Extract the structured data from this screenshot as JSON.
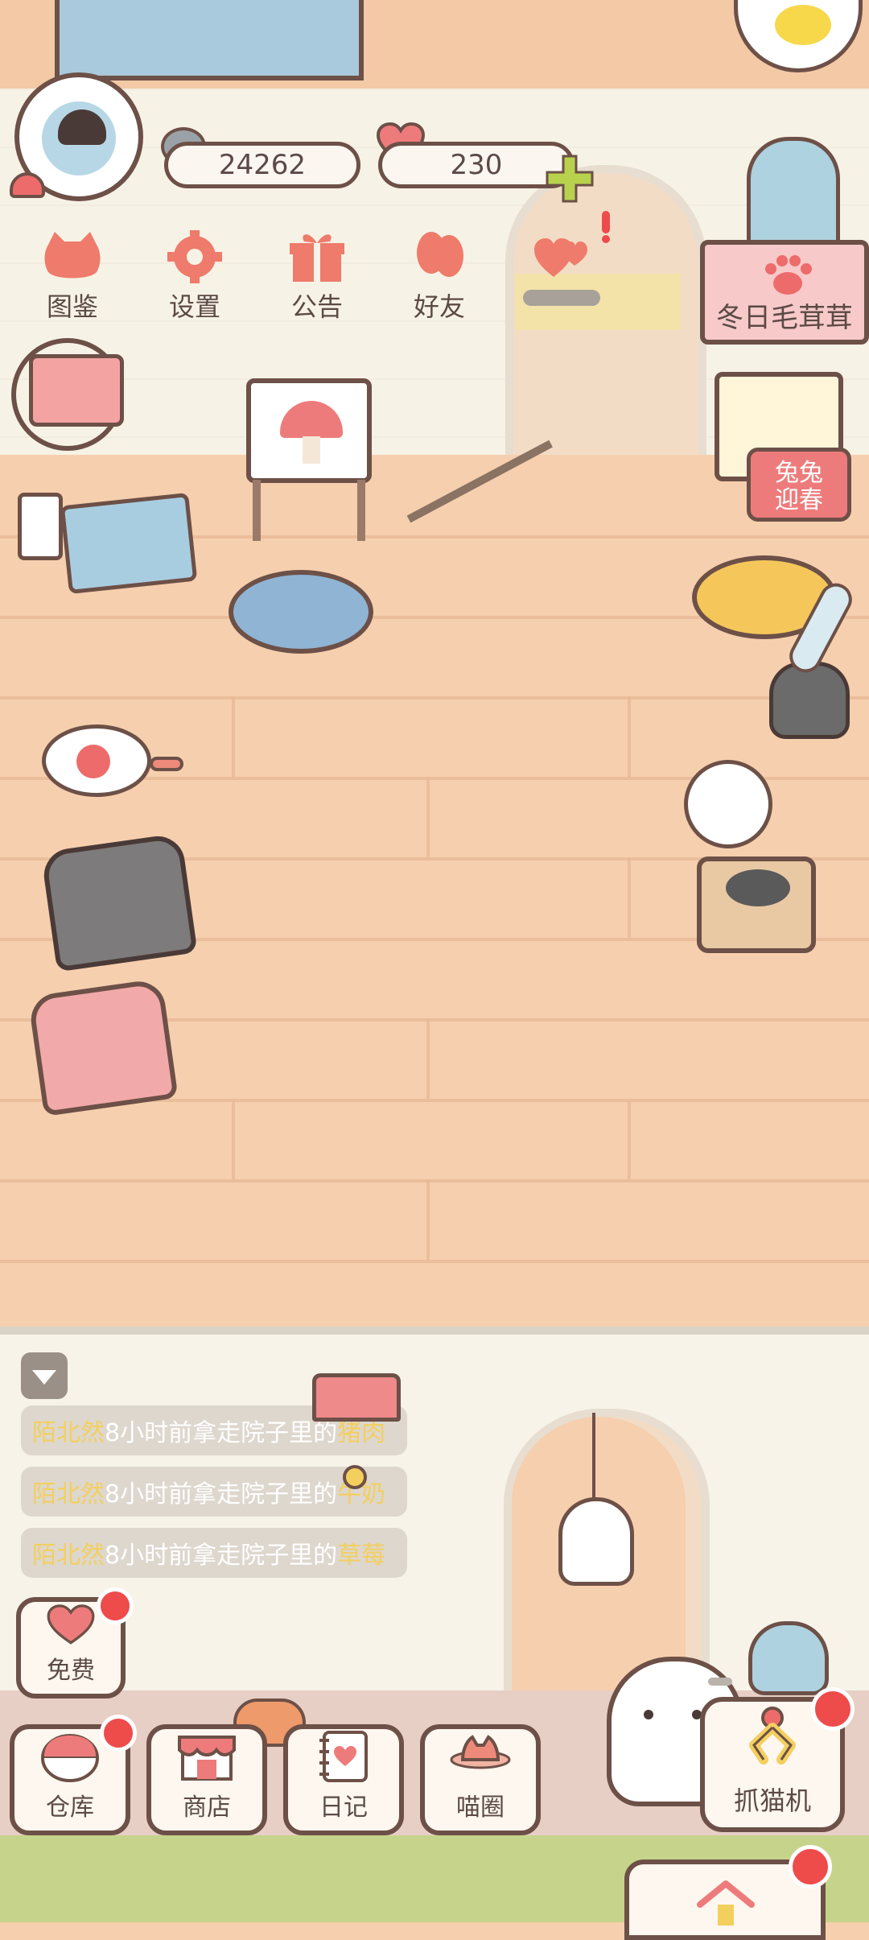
{
  "hud": {
    "fish_count": "24262",
    "heart_count": "230"
  },
  "menu": [
    {
      "label": "图鉴",
      "icon": "cat-head-icon"
    },
    {
      "label": "设置",
      "icon": "gear-icon"
    },
    {
      "label": "公告",
      "icon": "gift-icon"
    },
    {
      "label": "好友",
      "icon": "friends-icon"
    },
    {
      "label": "",
      "icon": "hearts-icon"
    }
  ],
  "event": {
    "banner_label": "冬日毛茸茸",
    "rabbit_sign": [
      "兔兔",
      "迎春"
    ]
  },
  "feed": [
    {
      "name": "陌北然",
      "text": "8小时前拿走院子里的",
      "item": "猪肉"
    },
    {
      "name": "陌北然",
      "text": "8小时前拿走院子里的",
      "item": "牛奶"
    },
    {
      "name": "陌北然",
      "text": "8小时前拿走院子里的",
      "item": "草莓"
    }
  ],
  "buttons": {
    "free": "免费",
    "warehouse": "仓库",
    "shop": "商店",
    "diary": "日记",
    "circle": "喵圈",
    "claw": "抓猫机"
  },
  "colors": {
    "accent_red": "#ee4b4b",
    "outline": "#6d5047",
    "floor": "#f6cfae",
    "name_yellow": "#f3cf5e"
  }
}
